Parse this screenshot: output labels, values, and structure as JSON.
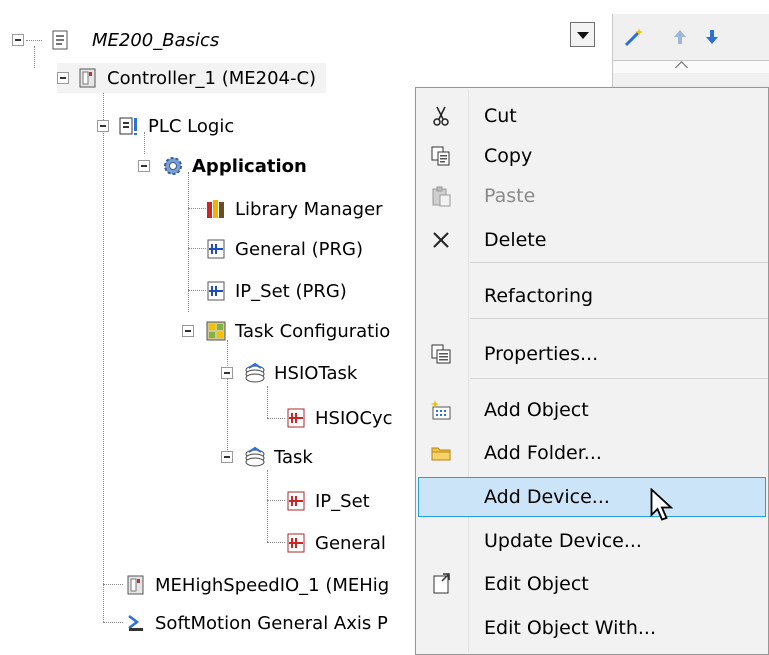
{
  "tree": {
    "project": "ME200_Basics",
    "controller": "Controller_1 (ME204-C)",
    "plc_logic": "PLC Logic",
    "application": "Application",
    "library_manager": "Library Manager",
    "general_prg": "General (PRG)",
    "ipset_prg": "IP_Set (PRG)",
    "task_config": "Task Configuratio",
    "hsio_task": "HSIOTask",
    "hsio_cyc": "HSIOCyc",
    "task": "Task",
    "task_ipset": "IP_Set",
    "task_general": "General",
    "mehighspeed": "MEHighSpeedIO_1 (MEHig",
    "softmotion": "SoftMotion General Axis P"
  },
  "context_menu": {
    "items": [
      {
        "label": "Cut",
        "icon": "scissors-icon"
      },
      {
        "label": "Copy",
        "icon": "copy-icon"
      },
      {
        "label": "Paste",
        "icon": "paste-icon",
        "disabled": true
      },
      {
        "label": "Delete",
        "icon": "delete-x-icon"
      },
      {
        "label": "Refactoring",
        "icon": ""
      },
      {
        "label": "Properties...",
        "icon": "properties-icon"
      },
      {
        "label": "Add Object",
        "icon": "add-object-icon"
      },
      {
        "label": "Add Folder...",
        "icon": "folder-icon"
      },
      {
        "label": "Add Device...",
        "icon": "",
        "highlighted": true
      },
      {
        "label": "Update Device...",
        "icon": ""
      },
      {
        "label": "Edit Object",
        "icon": "edit-object-icon"
      },
      {
        "label": "Edit Object With...",
        "icon": ""
      }
    ]
  },
  "colors": {
    "highlight_bg": "#cce4f7",
    "highlight_border": "#26a0da",
    "menu_bg": "#f2f2f2"
  }
}
